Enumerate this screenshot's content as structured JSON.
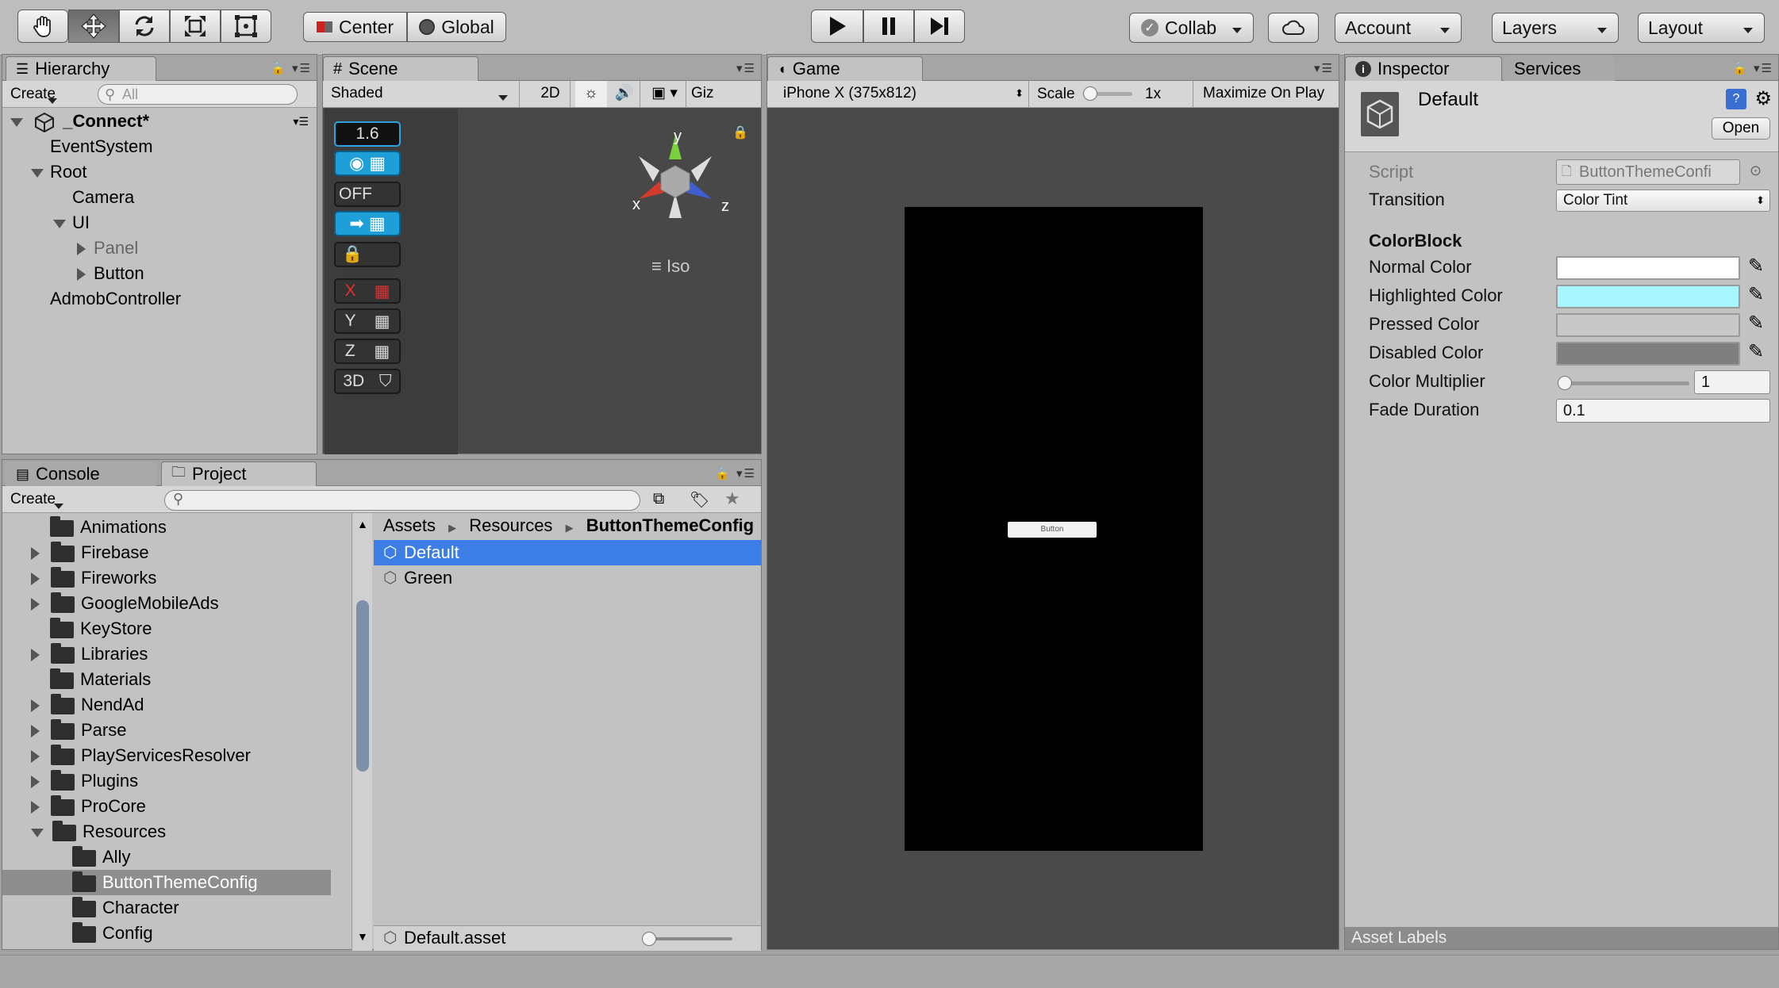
{
  "toolbar": {
    "pivot_center": "Center",
    "pivot_global": "Global",
    "collab": "Collab",
    "account": "Account",
    "layers": "Layers",
    "layout": "Layout"
  },
  "hierarchy": {
    "tab": "Hierarchy",
    "create": "Create",
    "search_placeholder": "All",
    "scene_name": "_Connect*",
    "items": [
      "EventSystem",
      "Root",
      "Camera",
      "UI",
      "Panel",
      "Button",
      "AdmobController"
    ]
  },
  "scene": {
    "tab": "Scene",
    "shading": "Shaded",
    "mode_2d": "2D",
    "gizmos": "Giz",
    "value": "1.6",
    "off_label": "OFF",
    "axis_x": "X",
    "axis_y": "Y",
    "axis_z": "Z",
    "btn_3d": "3D",
    "gizmo_y": "y",
    "gizmo_x": "x",
    "gizmo_z": "z",
    "projection": "Iso"
  },
  "game": {
    "tab": "Game",
    "resolution": "iPhone X (375x812)",
    "scale_label": "Scale",
    "scale_value": "1x",
    "maximize": "Maximize On Play",
    "button_text": "Button"
  },
  "inspector": {
    "tab": "Inspector",
    "services_tab": "Services",
    "object_name": "Default",
    "open_button": "Open",
    "script_label": "Script",
    "script_value": "ButtonThemeConfi",
    "transition_label": "Transition",
    "transition_value": "Color Tint",
    "colorblock_header": "ColorBlock",
    "normal_label": "Normal Color",
    "highlighted_label": "Highlighted Color",
    "pressed_label": "Pressed Color",
    "disabled_label": "Disabled Color",
    "multiplier_label": "Color Multiplier",
    "multiplier_value": "1",
    "fade_label": "Fade Duration",
    "fade_value": "0.1",
    "asset_labels": "Asset Labels",
    "colors": {
      "normal": "#ffffff",
      "highlighted": "#a6f5ff",
      "pressed": "#c8c8c8",
      "disabled": "#7f7f7f"
    }
  },
  "project": {
    "console_tab": "Console",
    "project_tab": "Project",
    "create": "Create",
    "folders": [
      "Animations",
      "Firebase",
      "Fireworks",
      "GoogleMobileAds",
      "KeyStore",
      "Libraries",
      "Materials",
      "NendAd",
      "Parse",
      "PlayServicesResolver",
      "Plugins",
      "ProCore",
      "Resources",
      "Ally",
      "ButtonThemeConfig",
      "Character",
      "Config"
    ],
    "breadcrumb": [
      "Assets",
      "Resources",
      "ButtonThemeConfig"
    ],
    "assets": [
      "Default",
      "Green"
    ],
    "footer_file": "Default.asset"
  }
}
